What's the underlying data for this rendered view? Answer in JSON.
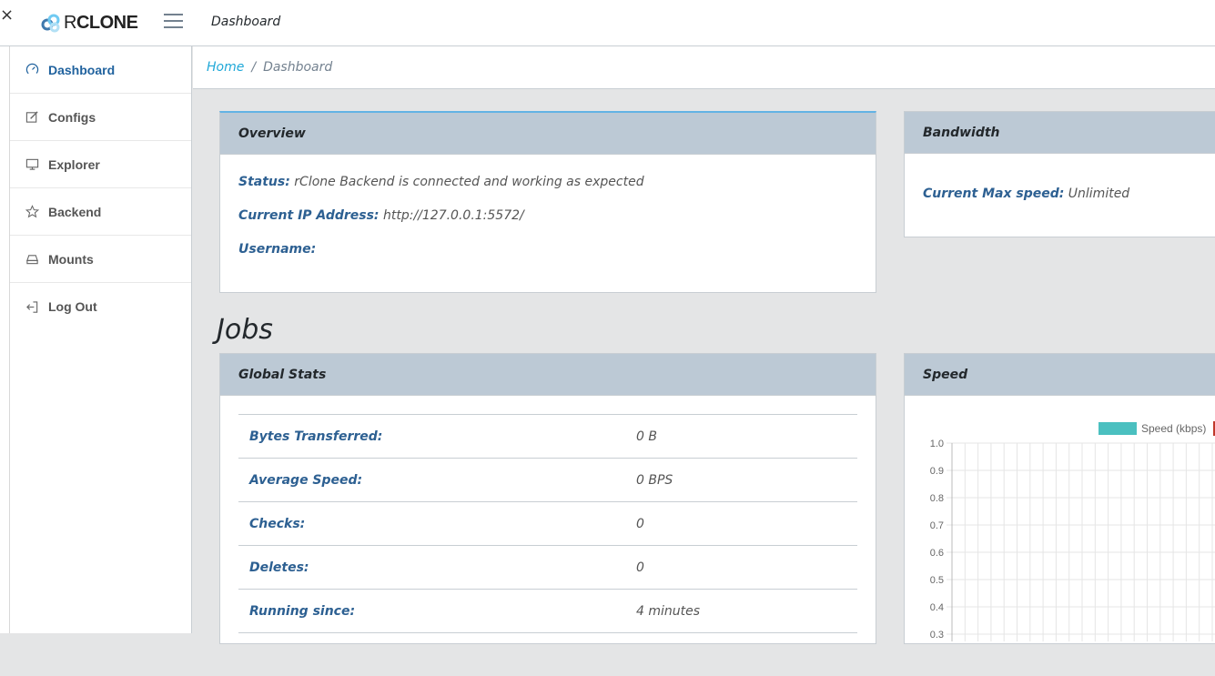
{
  "topbar": {
    "close_glyph": "×",
    "brand_name_prefix": "R",
    "brand_name_rest": "CLONE",
    "title": "Dashboard"
  },
  "sidebar": {
    "items": [
      {
        "label": "Dashboard",
        "icon": "speedometer-icon",
        "active": true
      },
      {
        "label": "Configs",
        "icon": "pencil-square-icon",
        "active": false
      },
      {
        "label": "Explorer",
        "icon": "monitor-icon",
        "active": false
      },
      {
        "label": "Backend",
        "icon": "star-icon",
        "active": false
      },
      {
        "label": "Mounts",
        "icon": "drive-icon",
        "active": false
      },
      {
        "label": "Log Out",
        "icon": "logout-icon",
        "active": false
      }
    ]
  },
  "breadcrumb": {
    "home": "Home",
    "separator": "/",
    "current": "Dashboard"
  },
  "overview": {
    "header": "Overview",
    "status_label": "Status:",
    "status_value": "rClone Backend is connected and working as expected",
    "ip_label": "Current IP Address:",
    "ip_value": "http://127.0.0.1:5572/",
    "username_label": "Username:",
    "username_value": ""
  },
  "bandwidth": {
    "header": "Bandwidth",
    "speed_label": "Current Max speed:",
    "speed_value": "Unlimited"
  },
  "jobs": {
    "title": "Jobs"
  },
  "global_stats": {
    "header": "Global Stats",
    "rows": [
      {
        "label": "Bytes Transferred:",
        "value": "0 B"
      },
      {
        "label": "Average Speed:",
        "value": "0 BPS"
      },
      {
        "label": "Checks:",
        "value": "0"
      },
      {
        "label": "Deletes:",
        "value": "0"
      },
      {
        "label": "Running since:",
        "value": "4 minutes"
      }
    ]
  },
  "speed": {
    "header": "Speed"
  },
  "colors": {
    "accent": "#20a8d8",
    "active_nav": "#20629e",
    "card_header": "#bcc9d5",
    "series_speed": "#4bc0c0",
    "series_second": "#c0392b"
  },
  "chart_data": {
    "type": "line",
    "title": "",
    "series": [
      {
        "name": "Speed (kbps)",
        "values": []
      }
    ],
    "y_ticks": [
      "1.0",
      "0.9",
      "0.8",
      "0.7",
      "0.6",
      "0.5",
      "0.4",
      "0.3"
    ],
    "ylim": [
      0,
      1
    ],
    "grid": true,
    "legend_position": "top"
  }
}
